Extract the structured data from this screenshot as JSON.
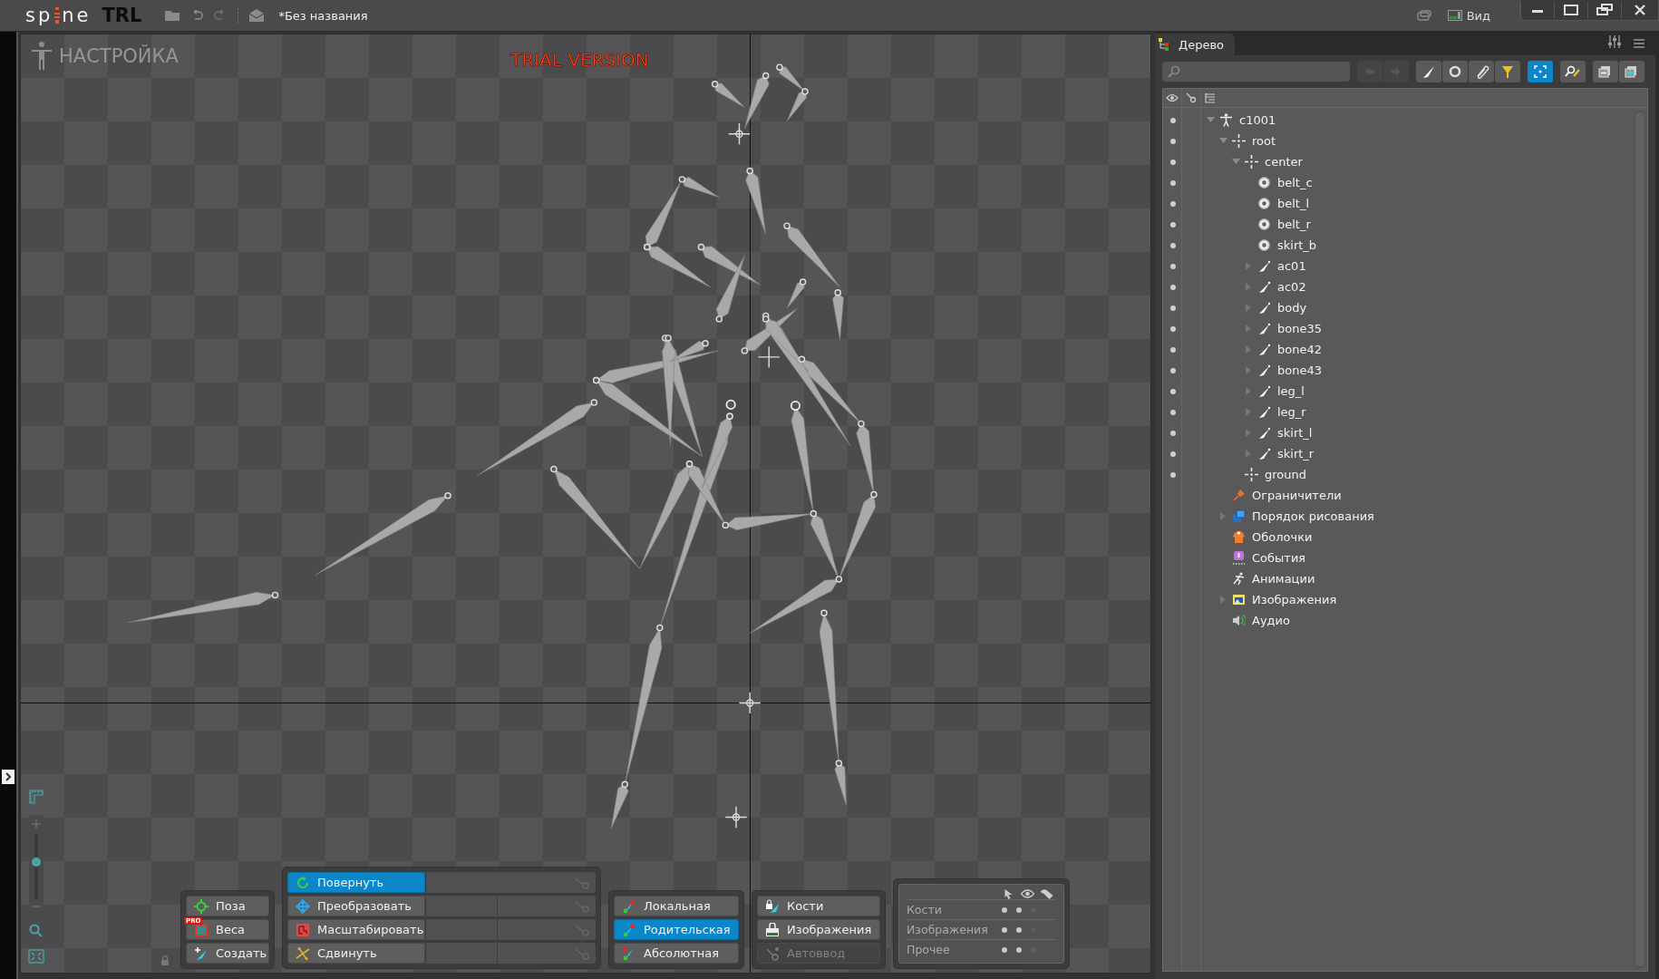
{
  "app": {
    "logo_left": "sp",
    "logo_right": "ne",
    "edition": "TRL",
    "document_title": "*Без названия",
    "view_menu": "Вид"
  },
  "viewport": {
    "mode_label": "НАСТРОЙКА",
    "watermark": "TRIAL VERSION",
    "zoom": {
      "level": 0.57
    }
  },
  "tools": {
    "modes": [
      {
        "label": "Поза",
        "kind": "pose",
        "selected": false
      },
      {
        "label": "Веса",
        "kind": "weights",
        "selected": false,
        "badge": "PRO"
      },
      {
        "label": "Создать",
        "kind": "create",
        "selected": false
      }
    ],
    "transforms": [
      {
        "label": "Повернуть",
        "kind": "rotate",
        "selected": true
      },
      {
        "label": "Преобразовать",
        "kind": "translate",
        "selected": false
      },
      {
        "label": "Масштабировать",
        "kind": "scale",
        "selected": false
      },
      {
        "label": "Сдвинуть",
        "kind": "shear",
        "selected": false
      }
    ],
    "axes": [
      {
        "label": "Локальная",
        "kind": "local",
        "selected": false
      },
      {
        "label": "Родительская",
        "kind": "parent",
        "selected": true
      },
      {
        "label": "Абсолютная",
        "kind": "world",
        "selected": false
      }
    ],
    "compensate": [
      {
        "label": "Кости",
        "kind": "bones",
        "disabled": false
      },
      {
        "label": "Изображения",
        "kind": "images",
        "disabled": false
      },
      {
        "label": "Автоввод",
        "kind": "autokey",
        "disabled": true
      }
    ],
    "visibility": [
      {
        "label": "Кости",
        "selectable": true,
        "visible": true,
        "names": false
      },
      {
        "label": "Изображения",
        "selectable": true,
        "visible": true,
        "names": false
      },
      {
        "label": "Прочее",
        "selectable": true,
        "visible": true,
        "names": false
      }
    ]
  },
  "tree_panel": {
    "tab": "Дерево"
  },
  "tree": [
    {
      "label": "c1001",
      "kind": "skeleton",
      "expandable": true,
      "expanded": true,
      "visible": true,
      "children": [
        {
          "label": "root",
          "kind": "origin",
          "expandable": true,
          "expanded": true,
          "visible": true,
          "children": [
            {
              "label": "center",
              "kind": "origin",
              "expandable": true,
              "expanded": true,
              "visible": true,
              "children": [
                {
                  "label": "belt_c",
                  "kind": "slot",
                  "expandable": false,
                  "visible": true
                },
                {
                  "label": "belt_l",
                  "kind": "slot",
                  "expandable": false,
                  "visible": true
                },
                {
                  "label": "belt_r",
                  "kind": "slot",
                  "expandable": false,
                  "visible": true
                },
                {
                  "label": "skirt_b",
                  "kind": "slot",
                  "expandable": false,
                  "visible": true
                },
                {
                  "label": "ac01",
                  "kind": "bone",
                  "expandable": true,
                  "expanded": false,
                  "visible": true
                },
                {
                  "label": "ac02",
                  "kind": "bone",
                  "expandable": true,
                  "expanded": false,
                  "visible": true
                },
                {
                  "label": "body",
                  "kind": "bone",
                  "expandable": true,
                  "expanded": false,
                  "visible": true
                },
                {
                  "label": "bone35",
                  "kind": "bone",
                  "expandable": true,
                  "expanded": false,
                  "visible": true
                },
                {
                  "label": "bone42",
                  "kind": "bone",
                  "expandable": true,
                  "expanded": false,
                  "visible": true
                },
                {
                  "label": "bone43",
                  "kind": "bone",
                  "expandable": true,
                  "expanded": false,
                  "visible": true
                },
                {
                  "label": "leg_l",
                  "kind": "bone",
                  "expandable": true,
                  "expanded": false,
                  "visible": true
                },
                {
                  "label": "leg_r",
                  "kind": "bone",
                  "expandable": true,
                  "expanded": false,
                  "visible": true
                },
                {
                  "label": "skirt_l",
                  "kind": "bone",
                  "expandable": true,
                  "expanded": false,
                  "visible": true
                },
                {
                  "label": "skirt_r",
                  "kind": "bone",
                  "expandable": true,
                  "expanded": false,
                  "visible": true
                }
              ]
            },
            {
              "label": "ground",
              "kind": "origin",
              "expandable": false,
              "visible": true
            }
          ]
        },
        {
          "label": "Ограничители",
          "kind": "constraints",
          "expandable": false
        },
        {
          "label": "Порядок рисования",
          "kind": "draw-order",
          "expandable": true,
          "expanded": false
        },
        {
          "label": "Оболочки",
          "kind": "skins",
          "expandable": false
        },
        {
          "label": "События",
          "kind": "events",
          "expandable": false
        },
        {
          "label": "Анимации",
          "kind": "animations",
          "expandable": false
        },
        {
          "label": "Изображения",
          "kind": "images",
          "expandable": true,
          "expanded": false
        },
        {
          "label": "Аудио",
          "kind": "audio",
          "expandable": false
        }
      ]
    }
  ]
}
